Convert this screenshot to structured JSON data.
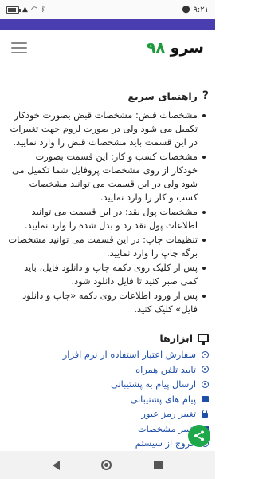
{
  "status_bar": {
    "time": "۹:۲۱",
    "battery": "",
    "icons": [
      "battery-icon",
      "signal-icon",
      "wifi-icon",
      "bluetooth-icon"
    ]
  },
  "app": {
    "name": "سرو",
    "name_number": "۹۸"
  },
  "guide": {
    "title": "راهنمای سریع",
    "items": [
      "مشخصات قبض: مشخصات قبض بصورت خودکار تکمیل می شود ولی در صورت لزوم جهت تغییرات در این قسمت باید مشخصات قبض را وارد نمایید.",
      "مشخصات کسب و کار: این قسمت بصورت خودکار از روی مشخصات پروفایل شما تکمیل می شود ولی در این قسمت می توانید مشخصات کسب و کار را وارد نمایید.",
      "مشخصات پول نقد: در این قسمت می توانید اطلاعات پول نقد رد و بدل شده را وارد نمایید.",
      "تنظیمات چاپ: در این قسمت می توانید مشخصات برگه چاپ را وارد نمایید.",
      "پس از کلیک روی دکمه چاپ و دانلود فایل، باید کمی صبر کنید تا فایل دانلود شود.",
      "پس از ورود اطلاعات روی دکمه «چاپ و دانلود فایل» کلیک کنید."
    ]
  },
  "tools": {
    "title": "ابزارها",
    "items": [
      {
        "label": "سفارش اعتبار استفاده از نرم افزار",
        "icon": "info-circle-icon"
      },
      {
        "label": "تایید تلفن همراه",
        "icon": "check-circle-icon"
      },
      {
        "label": "ارسال پیام به پشتیبانی",
        "icon": "send-icon"
      },
      {
        "label": "پیام های پشتیبانی",
        "icon": "message-icon"
      },
      {
        "label": "تغییر رمز عبور",
        "icon": "lock-icon"
      },
      {
        "label": "تغییر مشخصات",
        "icon": "user-icon"
      },
      {
        "label": "خروج از سیستم",
        "icon": "logout-icon"
      }
    ],
    "more": "..."
  },
  "colors": {
    "accent_bar": "#4a3db0",
    "brand_green": "#1c9b3a",
    "link_blue": "#1e4fa8",
    "fab_green": "#1fa84a"
  }
}
